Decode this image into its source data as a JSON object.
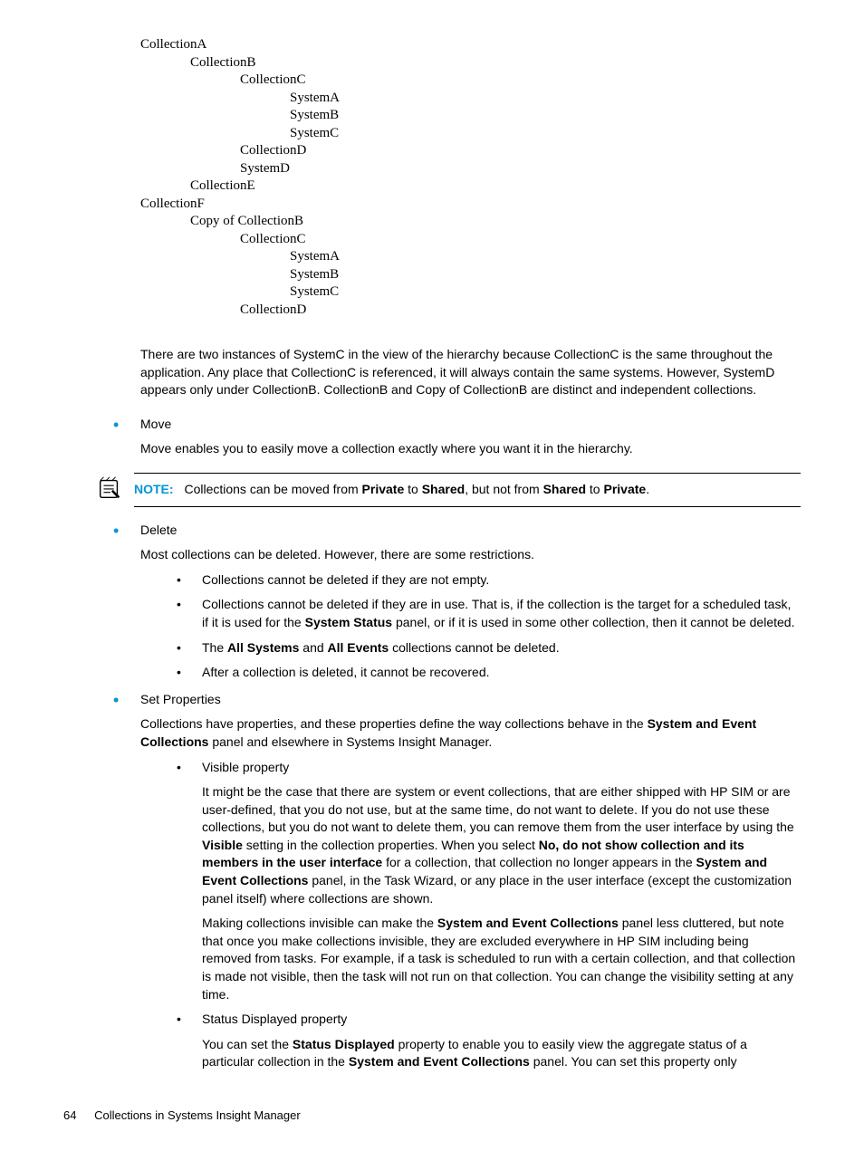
{
  "hierarchy": [
    {
      "indent": 0,
      "text": "CollectionA"
    },
    {
      "indent": 1,
      "text": "CollectionB"
    },
    {
      "indent": 2,
      "text": "CollectionC"
    },
    {
      "indent": 3,
      "text": "SystemA"
    },
    {
      "indent": 3,
      "text": "SystemB"
    },
    {
      "indent": 3,
      "text": "SystemC"
    },
    {
      "indent": 2,
      "text": "CollectionD"
    },
    {
      "indent": 2,
      "text": "SystemD"
    },
    {
      "indent": 1,
      "text": "CollectionE"
    },
    {
      "indent": 0,
      "text": "CollectionF"
    },
    {
      "indent": 1,
      "text": "Copy of CollectionB"
    },
    {
      "indent": 2,
      "text": "CollectionC"
    },
    {
      "indent": 3,
      "text": "SystemA"
    },
    {
      "indent": 3,
      "text": "SystemB"
    },
    {
      "indent": 3,
      "text": "SystemC"
    },
    {
      "indent": 2,
      "text": "CollectionD"
    }
  ],
  "para1": "There are two instances of SystemC in the view of the hierarchy because CollectionC is the same throughout the application. Any place that CollectionC is referenced, it will always contain the same systems. However, SystemD appears only under CollectionB. CollectionB and Copy of CollectionB are distinct and independent collections.",
  "move": {
    "title": "Move",
    "body": "Move enables you to easily move a collection exactly where you want it in the hierarchy."
  },
  "note": {
    "label": "NOTE:",
    "pre": "Collections can be moved from ",
    "b1": "Private",
    "mid": " to ",
    "b2": "Shared",
    "post1": ", but not from ",
    "b3": "Shared",
    "post2": " to ",
    "b4": "Private",
    "end": "."
  },
  "delete": {
    "title": "Delete",
    "body": "Most collections can be deleted. However, there are some restrictions.",
    "sub1": "Collections cannot be deleted if they are not empty.",
    "sub2": {
      "pre": "Collections cannot be deleted if they are in use. That is, if the collection is the target for a scheduled task, if it is used for the ",
      "b1": "System Status",
      "post": " panel, or if it is used in some other collection, then it cannot be deleted."
    },
    "sub3": {
      "pre": "The ",
      "b1": "All Systems",
      "mid": " and ",
      "b2": "All Events",
      "post": " collections cannot be deleted."
    },
    "sub4": "After a collection is deleted, it cannot be recovered."
  },
  "setprops": {
    "title": "Set Properties",
    "body": {
      "pre": "Collections have properties, and these properties define the way collections behave in the ",
      "b1": "System and Event Collections",
      "post": " panel and elsewhere in Systems Insight Manager."
    },
    "visible": {
      "title": "Visible property",
      "p1": {
        "pre": "It might be the case that there are system or event collections, that are either shipped with HP SIM or are user-defined, that you do not use, but at the same time, do not want to delete. If you do not use these collections, but you do not want to delete them, you can remove them from the user interface by using the ",
        "b1": "Visible",
        "mid1": " setting in the collection properties. When you select ",
        "b2": "No, do not show collection and its members in the user interface",
        "mid2": " for a collection, that collection no longer appears in the ",
        "b3": "System and Event Collections",
        "post": " panel, in the Task Wizard, or any place in the user interface (except the customization panel itself) where collections are shown."
      },
      "p2": {
        "pre": "Making collections invisible can make the ",
        "b1": "System and Event Collections",
        "post": " panel less cluttered, but note that once you make collections invisible, they are excluded everywhere in HP SIM including being removed from tasks. For example, if a task is scheduled to run with a certain collection, and that collection is made not visible, then the task will not run on that collection. You can change the visibility setting at any time."
      }
    },
    "status": {
      "title": "Status Displayed property",
      "p1": {
        "pre": "You can set the ",
        "b1": "Status Displayed",
        "mid": " property to enable you to easily view the aggregate status of a particular collection in the ",
        "b2": "System and Event Collections",
        "post": " panel. You can set this property only"
      }
    }
  },
  "footer": {
    "page": "64",
    "title": "Collections in Systems Insight Manager"
  }
}
